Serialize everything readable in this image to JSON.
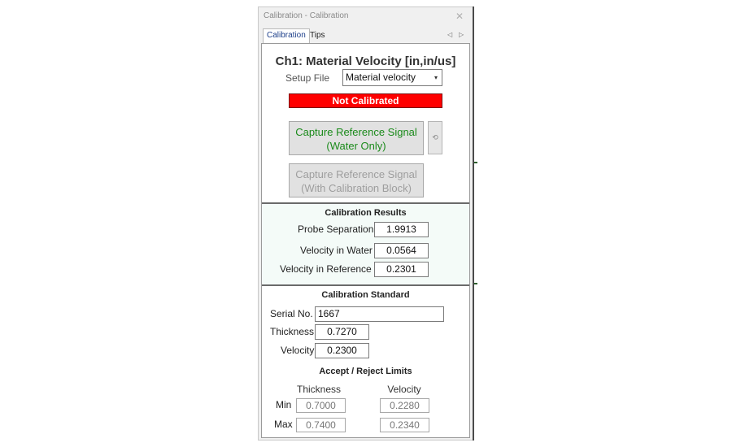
{
  "window": {
    "title": "Calibration - Calibration",
    "close_glyph": "✕"
  },
  "tabs": [
    {
      "label": "Calibration",
      "active": true
    },
    {
      "label": "Tips",
      "active": false
    }
  ],
  "tab_nav": {
    "prev": "◁",
    "next": "▷"
  },
  "header": "Ch1: Material Velocity [in,in/us]",
  "setup_file": {
    "label": "Setup File",
    "value": "Material velocity"
  },
  "status": {
    "text": "Not Calibrated",
    "color": "#ff0000"
  },
  "capture_water": {
    "line1": "Capture Reference Signal",
    "line2": "(Water Only)",
    "color": "#1a8a1a"
  },
  "capture_block": {
    "line1": "Capture Reference Signal",
    "line2": "(With Calibration Block)"
  },
  "results": {
    "title": "Calibration Results",
    "rows": [
      {
        "label": "Probe Separation",
        "value": "1.9913"
      },
      {
        "label": "Velocity in Water",
        "value": "0.0564"
      },
      {
        "label": "Velocity in Reference",
        "value": "0.2301"
      }
    ]
  },
  "standard": {
    "title": "Calibration Standard",
    "serial": {
      "label": "Serial No.",
      "value": "1667"
    },
    "thickness": {
      "label": "Thickness",
      "value": "0.7270"
    },
    "velocity": {
      "label": "Velocity",
      "value": "0.2300"
    }
  },
  "limits": {
    "title": "Accept / Reject Limits",
    "col_thickness": "Thickness",
    "col_velocity": "Velocity",
    "min": {
      "label": "Min",
      "thickness": "0.7000",
      "velocity": "0.2280"
    },
    "max": {
      "label": "Max",
      "thickness": "0.7400",
      "velocity": "0.2340"
    }
  }
}
